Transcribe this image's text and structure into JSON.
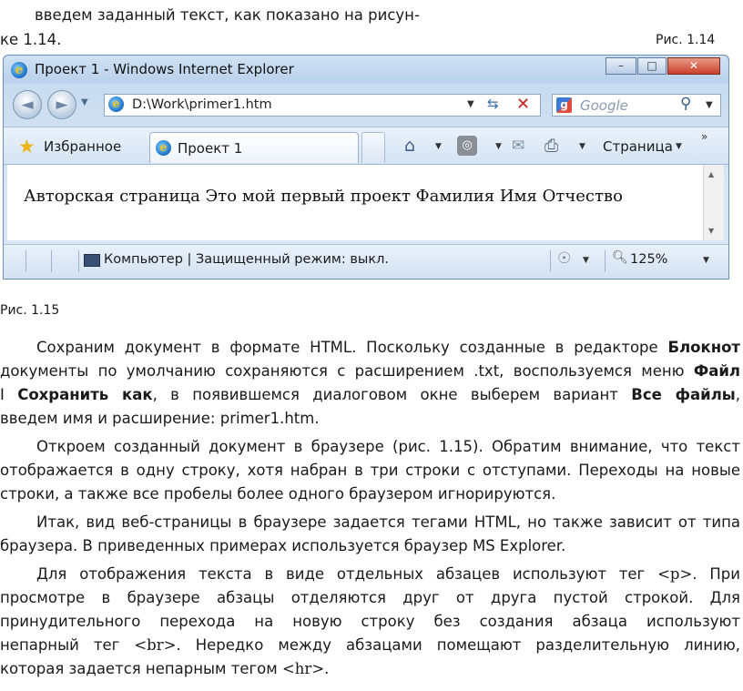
{
  "text": {
    "intro_line1": "введем заданный текст, как показано на рисун-",
    "intro_line2": "ке 1.14.",
    "fig_114": "Рис. 1.14",
    "fig_115": "Рис. 1.15"
  },
  "browser": {
    "window_title": "Проект 1 - Windows Internet Explorer",
    "minimize": "–",
    "maximize": "□",
    "close": "✕",
    "back": "◄",
    "forward": "►",
    "address_value": "D:\\Work\\primer1.htm",
    "search_placeholder": "Google",
    "favorites_label": "Избранное",
    "tab_label": "Проект 1",
    "page_menu_label": "Страница",
    "page_content": "Авторская страница Это мой первый проект Фамилия Имя Отчество",
    "status_text": "Компьютер | Защищенный режим: выкл.",
    "zoom": "125%"
  },
  "paragraphs": {
    "p1": {
      "l1a": "Сохраним документ в формате HTML. Поскольку созданные в редакторе ",
      "l1b": "Блокнот",
      "l2a": "документы по умолчанию сохраняются с расширением .txt, воспользуемся меню ",
      "l2b": "Файл",
      "l3a": "I ",
      "l3b": "Сохранить как",
      "l3c": ", в появившемся диалоговом окне выберем вариант ",
      "l3d": "Все файлы",
      "l3e": ",",
      "l4": "введем имя и расширение: primer1.htm."
    },
    "p2": {
      "l1": "Откроем созданный документ в браузере (рис. 1.15). Обратим внимание, что текст",
      "l2": "отображается в одну строку, хотя набран в три строки с отступами. Переходы на новые",
      "l3": "строки, а также все пробелы более одного браузером игнорируются."
    },
    "p3": {
      "l1": "Итак, вид веб-страницы в браузере задается тегами HTML, но также зависит от типа",
      "l2": "браузера. В приведенных примерах используется браузер MS Explorer."
    },
    "p4": {
      "l1a": "Для отображения текста в виде отдельных абзацев используют тег ",
      "l1b": "<p>",
      "l1c": ". При",
      "l2": "просмотре в браузере абзацы отделяются друг от друга пустой строкой. Для",
      "l3": "принудительного перехода на новую строку без создания абзаца используют",
      "l4a": "непарный тег ",
      "l4b": "<br>",
      "l4c": ". Нередко между абзацами помещают разделительную линию,",
      "l5a": "которая задается непарным тегом ",
      "l5b": "<hr>",
      "l5c": "."
    }
  }
}
